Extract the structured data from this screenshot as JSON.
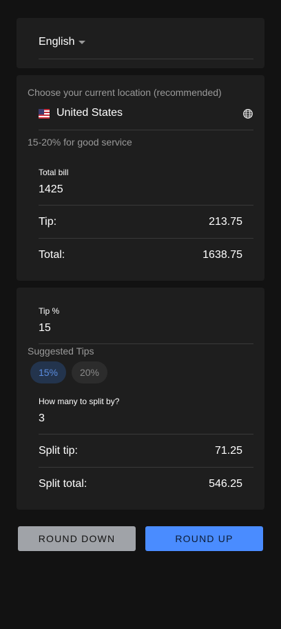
{
  "language": {
    "selected": "English"
  },
  "location": {
    "label": "Choose your current location (recommended)",
    "country": "United States",
    "hint": "15-20% for good service"
  },
  "bill": {
    "total_bill_label": "Total bill",
    "total_bill_value": "1425",
    "tip_label": "Tip:",
    "tip_value": "213.75",
    "total_label": "Total:",
    "total_value": "1638.75"
  },
  "split": {
    "tip_percent_label": "Tip %",
    "tip_percent_value": "15",
    "suggested_label": "Suggested Tips",
    "suggestions": [
      "15%",
      "20%"
    ],
    "selected_suggestion": "15%",
    "split_by_label": "How many to split by?",
    "split_by_value": "3",
    "split_tip_label": "Split tip:",
    "split_tip_value": "71.25",
    "split_total_label": "Split total:",
    "split_total_value": "546.25"
  },
  "actions": {
    "round_down": "ROUND DOWN",
    "round_up": "ROUND UP"
  },
  "colors": {
    "background": "#121212",
    "card": "#1e1e1e",
    "accent": "#4a8cff",
    "chip_selected_text": "#5b8de0",
    "round_down_bg": "#a0a3a8"
  },
  "icons": {
    "flag": "us-flag-icon",
    "globe": "globe-icon",
    "dropdown": "caret-down-icon"
  }
}
